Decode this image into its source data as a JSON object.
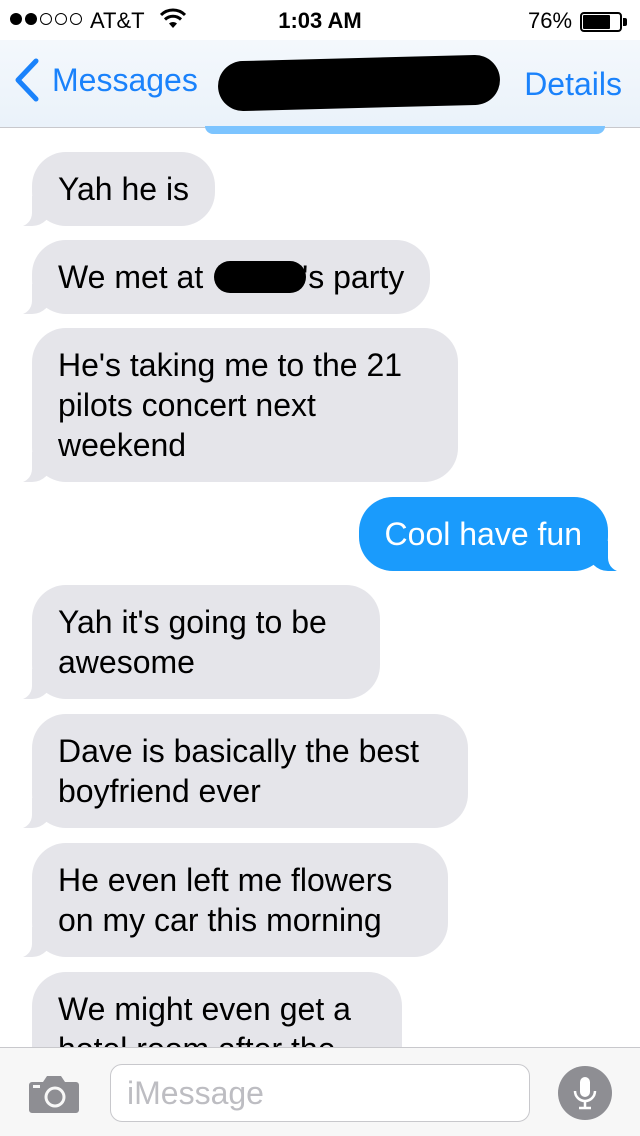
{
  "status_bar": {
    "carrier": "AT&T",
    "time": "1:03 AM",
    "battery_percent": "76%",
    "battery_level": 0.76,
    "signal_bars": 2,
    "signal_total": 5
  },
  "nav": {
    "back_label": "Messages",
    "details_label": "Details"
  },
  "messages": [
    {
      "direction": "incoming",
      "text": "Yah he is"
    },
    {
      "direction": "incoming",
      "text_before": "We met at",
      "text_after": "'s party",
      "redacted": true
    },
    {
      "direction": "incoming",
      "text": "He's taking me to the 21 pilots concert next weekend"
    },
    {
      "direction": "outgoing",
      "text": "Cool have fun"
    },
    {
      "direction": "incoming",
      "text": "Yah it's going to be awesome"
    },
    {
      "direction": "incoming",
      "text": "Dave is basically the best boyfriend ever"
    },
    {
      "direction": "incoming",
      "text": "He even left me flowers on my car this morning"
    },
    {
      "direction": "incoming",
      "text": "We might even get a hotel room after the"
    }
  ],
  "input_bar": {
    "placeholder": "iMessage"
  },
  "colors": {
    "accent": "#1a82fb",
    "incoming_bubble": "#e5e5ea",
    "outgoing_bubble": "#1a9bfc"
  },
  "icons": [
    "wifi-icon",
    "battery-icon",
    "chevron-left-icon",
    "camera-icon",
    "microphone-icon"
  ]
}
